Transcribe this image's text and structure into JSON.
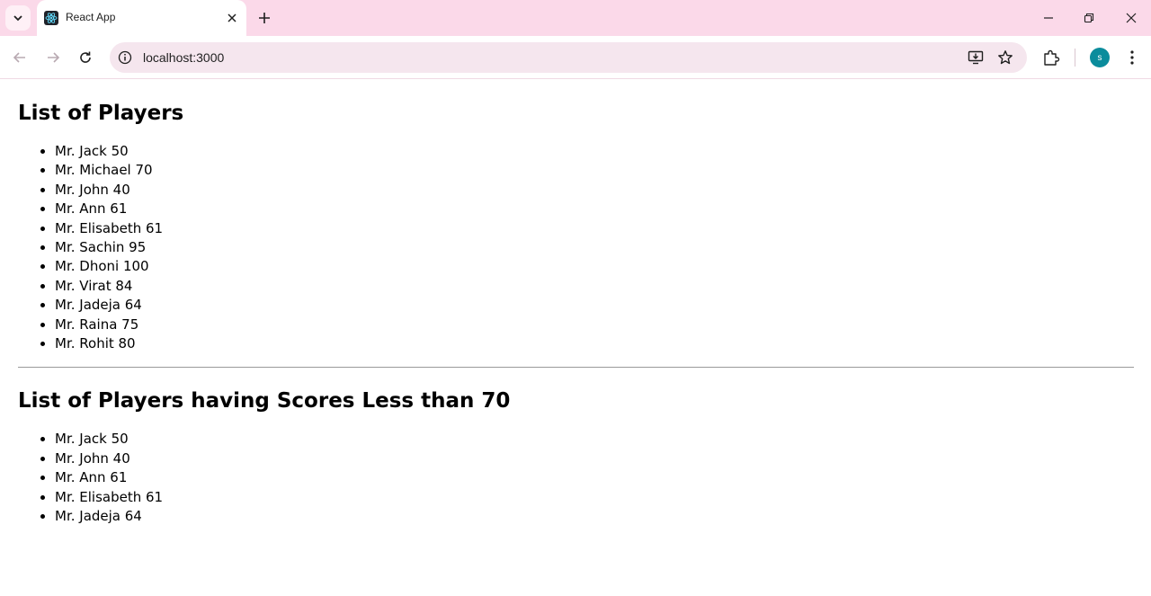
{
  "browser": {
    "tab_title": "React App",
    "url": "localhost:3000",
    "profile_initial": "s"
  },
  "page": {
    "heading_all": "List of Players",
    "players": [
      "Mr. Jack 50",
      "Mr. Michael 70",
      "Mr. John 40",
      "Mr. Ann 61",
      "Mr. Elisabeth 61",
      "Mr. Sachin 95",
      "Mr. Dhoni 100",
      "Mr. Virat 84",
      "Mr. Jadeja 64",
      "Mr. Raina 75",
      "Mr. Rohit 80"
    ],
    "heading_filtered": "List of Players having Scores Less than 70",
    "filtered_players": [
      "Mr. Jack 50",
      "Mr. John 40",
      "Mr. Ann 61",
      "Mr. Elisabeth 61",
      "Mr. Jadeja 64"
    ]
  },
  "icons": {
    "tab_search": "chevron-down-icon",
    "favicon": "react-logo-icon",
    "tab_close": "close-icon",
    "new_tab": "plus-icon",
    "minimize": "minimize-icon",
    "restore": "restore-icon",
    "close_window": "close-icon",
    "back": "arrow-left-icon",
    "forward": "arrow-right-icon",
    "reload": "reload-icon",
    "site_info": "info-icon",
    "install": "install-app-icon",
    "bookmark": "star-icon",
    "extensions": "puzzle-icon",
    "menu": "kebab-menu-icon"
  },
  "colors": {
    "tabstrip_bg": "#fbd9e9",
    "omnibox_bg": "#f5e6ee",
    "avatar_bg": "#0b8c9c"
  }
}
